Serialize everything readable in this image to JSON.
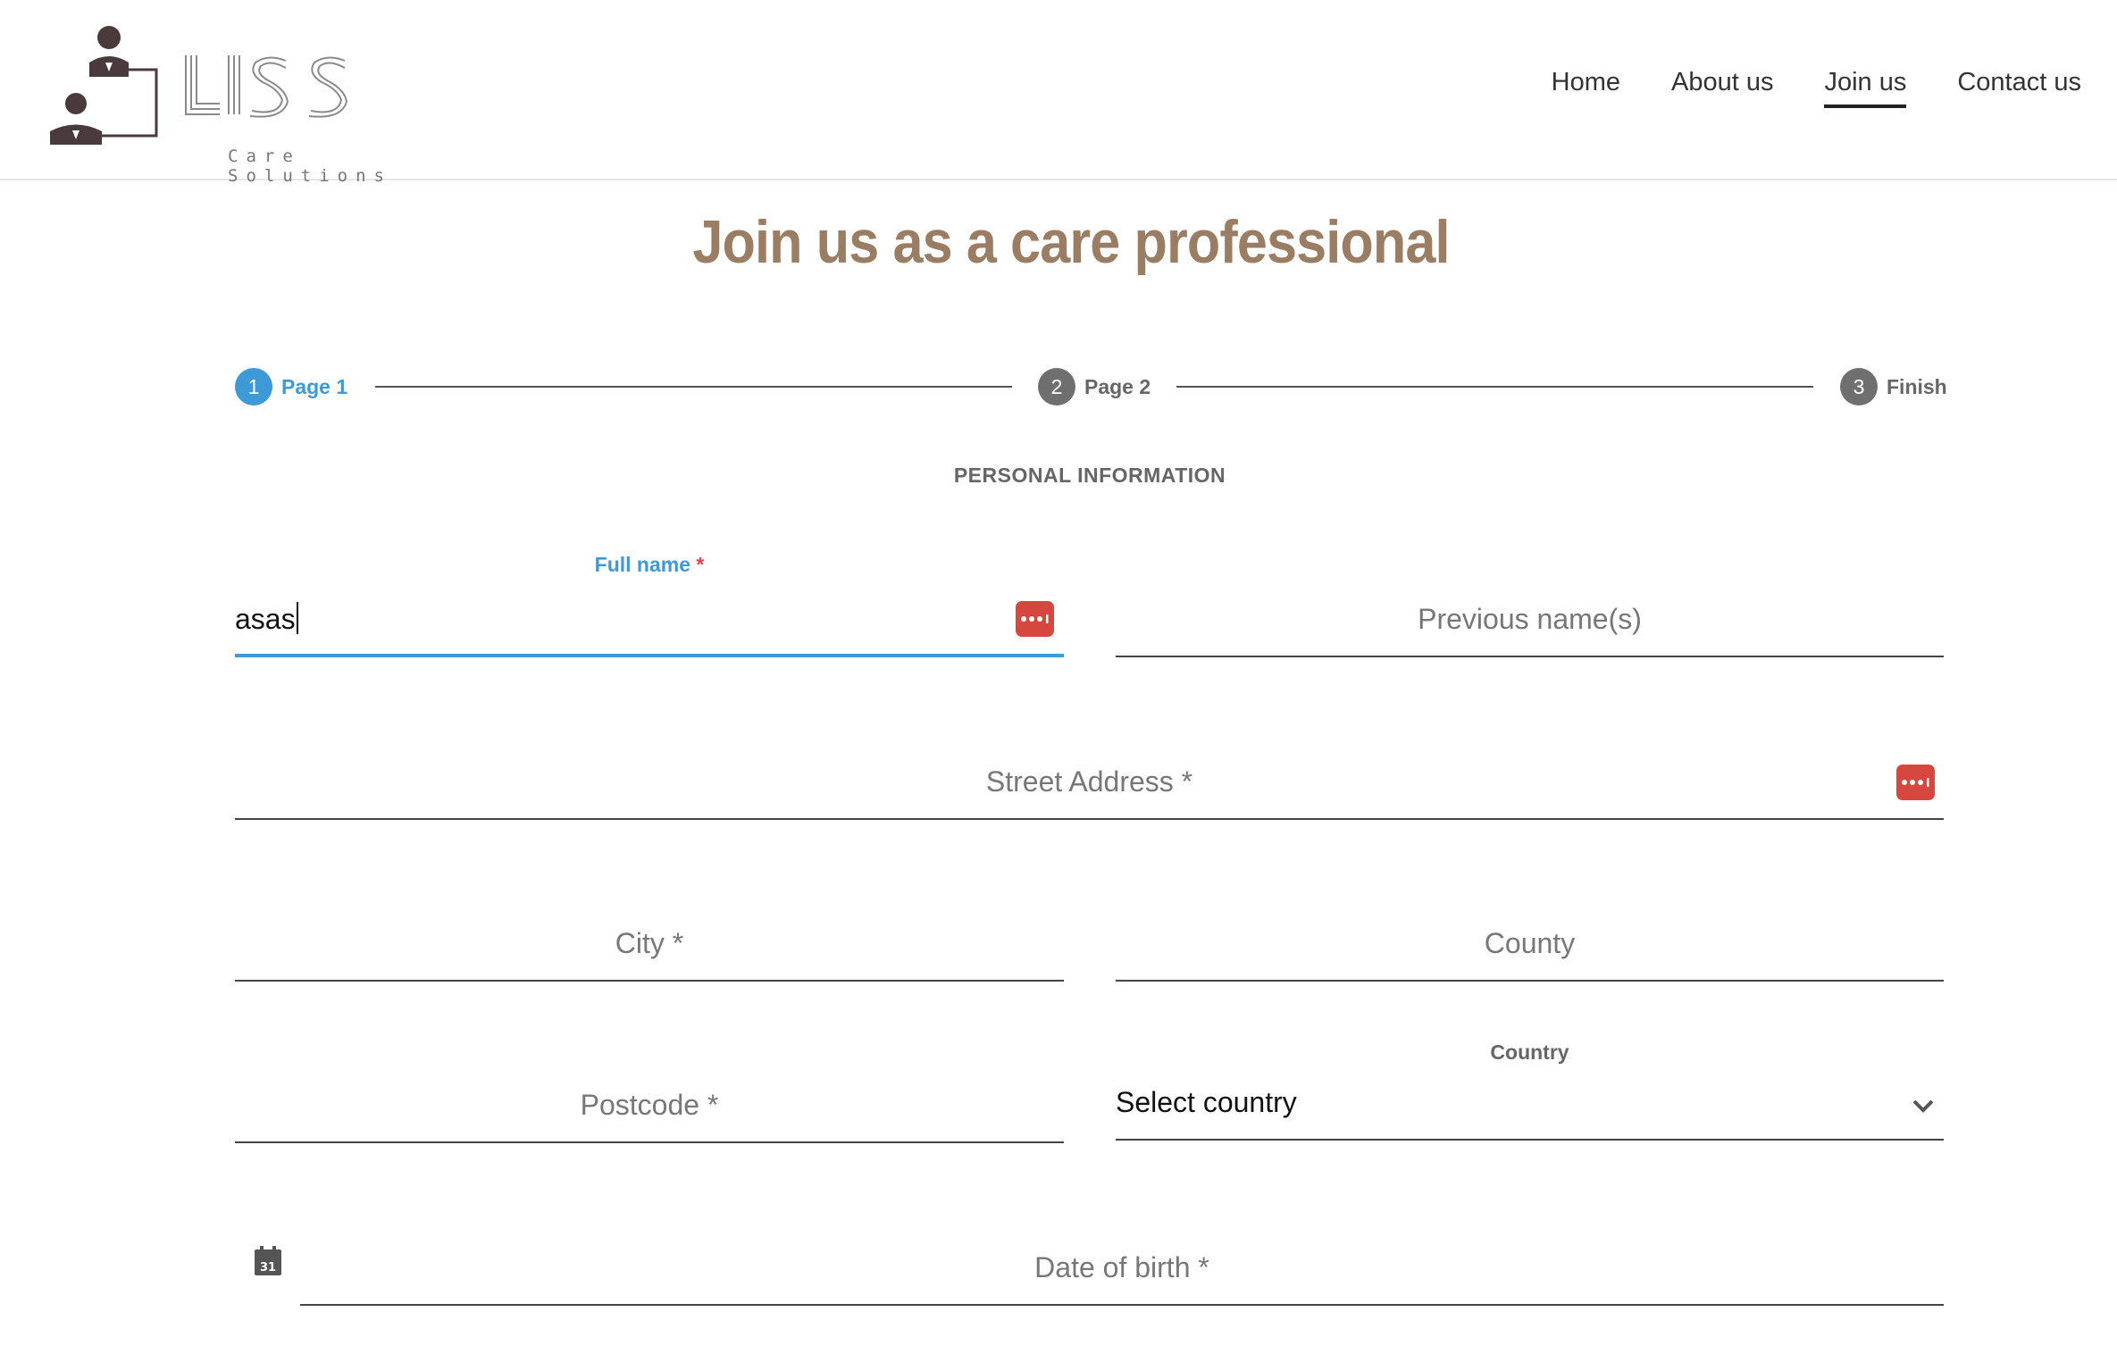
{
  "header": {
    "logo_text": "LISS",
    "logo_tagline": "Care Solutions",
    "nav": [
      {
        "label": "Home",
        "active": false
      },
      {
        "label": "About us",
        "active": false
      },
      {
        "label": "Join us",
        "active": true
      },
      {
        "label": "Contact us",
        "active": false
      }
    ]
  },
  "page": {
    "title": "Join us as a care professional",
    "section_title": "PERSONAL INFORMATION"
  },
  "stepper": {
    "steps": [
      {
        "number": "1",
        "label": "Page 1",
        "active": true
      },
      {
        "number": "2",
        "label": "Page 2",
        "active": false
      },
      {
        "number": "3",
        "label": "Finish",
        "active": false
      }
    ]
  },
  "form": {
    "full_name": {
      "label": "Full name",
      "required_mark": "*",
      "value": "asas"
    },
    "previous_names": {
      "placeholder": "Previous name(s)"
    },
    "street_address": {
      "placeholder": "Street Address *"
    },
    "city": {
      "placeholder": "City *"
    },
    "county": {
      "placeholder": "County"
    },
    "postcode": {
      "placeholder": "Postcode *"
    },
    "country": {
      "label": "Country",
      "value": "Select country"
    },
    "date_of_birth": {
      "placeholder": "Date of birth *",
      "calendar_day": "31"
    }
  },
  "colors": {
    "accent": "#3d9ad6",
    "title": "#9a7d63",
    "password_manager_icon": "#d6473f",
    "required": "#e0474c"
  },
  "icons": {
    "password_manager": "password-dots-icon",
    "dropdown": "chevron-down-icon",
    "calendar": "calendar-icon"
  }
}
